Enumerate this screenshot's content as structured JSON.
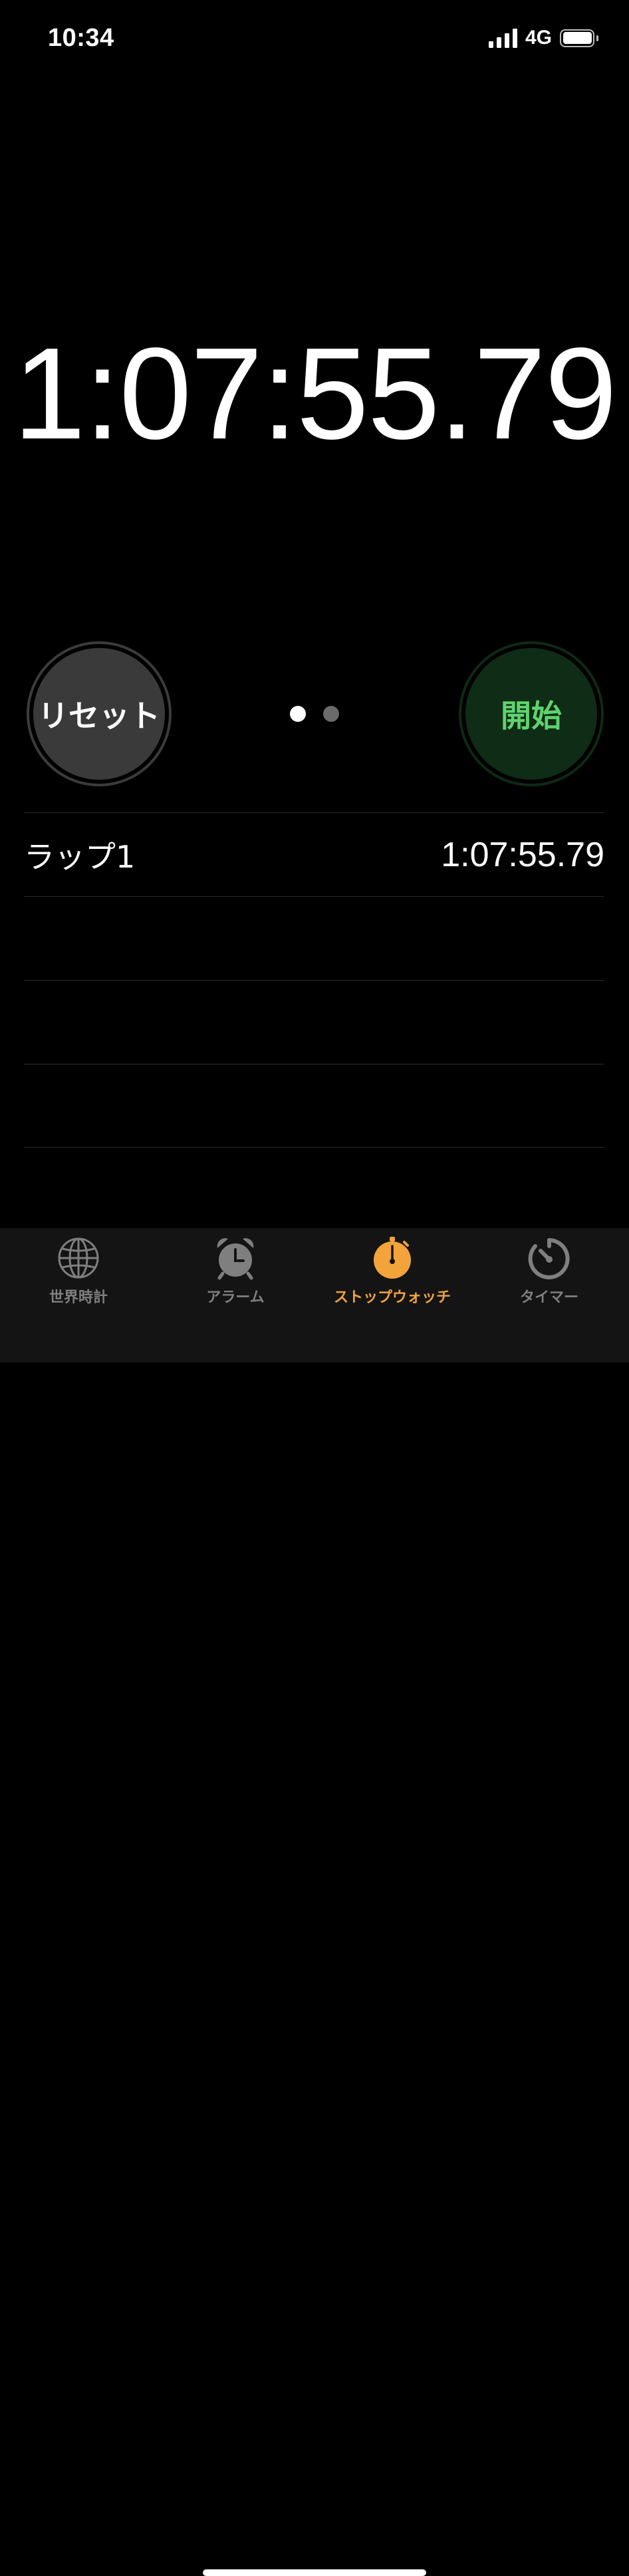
{
  "status_bar": {
    "time": "10:34",
    "network": "4G"
  },
  "stopwatch": {
    "elapsed": "1:07:55.79"
  },
  "controls": {
    "reset_label": "リセット",
    "start_label": "開始"
  },
  "pager": {
    "pages": 2,
    "active_page": 1
  },
  "laps": [
    {
      "label": "ラップ1",
      "time": "1:07:55.79"
    }
  ],
  "tab_bar": {
    "tabs": [
      {
        "label": "世界時計",
        "icon": "globe-icon"
      },
      {
        "label": "アラーム",
        "icon": "alarm-clock-icon"
      },
      {
        "label": "ストップウォッチ",
        "icon": "stopwatch-icon",
        "active": true
      },
      {
        "label": "タイマー",
        "icon": "timer-icon"
      }
    ]
  },
  "colors": {
    "accent": "#f2a33a",
    "start_green": "#5fd36d"
  }
}
